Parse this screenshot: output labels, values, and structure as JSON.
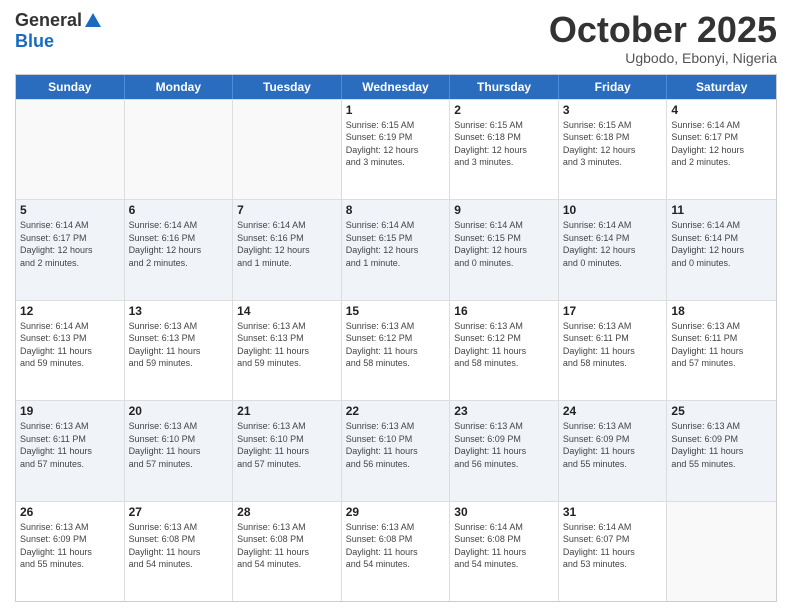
{
  "logo": {
    "general": "General",
    "blue": "Blue"
  },
  "header": {
    "month": "October 2025",
    "location": "Ugbodo, Ebonyi, Nigeria"
  },
  "dayHeaders": [
    "Sunday",
    "Monday",
    "Tuesday",
    "Wednesday",
    "Thursday",
    "Friday",
    "Saturday"
  ],
  "weeks": [
    [
      {
        "day": "",
        "info": ""
      },
      {
        "day": "",
        "info": ""
      },
      {
        "day": "",
        "info": ""
      },
      {
        "day": "1",
        "info": "Sunrise: 6:15 AM\nSunset: 6:19 PM\nDaylight: 12 hours\nand 3 minutes."
      },
      {
        "day": "2",
        "info": "Sunrise: 6:15 AM\nSunset: 6:18 PM\nDaylight: 12 hours\nand 3 minutes."
      },
      {
        "day": "3",
        "info": "Sunrise: 6:15 AM\nSunset: 6:18 PM\nDaylight: 12 hours\nand 3 minutes."
      },
      {
        "day": "4",
        "info": "Sunrise: 6:14 AM\nSunset: 6:17 PM\nDaylight: 12 hours\nand 2 minutes."
      }
    ],
    [
      {
        "day": "5",
        "info": "Sunrise: 6:14 AM\nSunset: 6:17 PM\nDaylight: 12 hours\nand 2 minutes."
      },
      {
        "day": "6",
        "info": "Sunrise: 6:14 AM\nSunset: 6:16 PM\nDaylight: 12 hours\nand 2 minutes."
      },
      {
        "day": "7",
        "info": "Sunrise: 6:14 AM\nSunset: 6:16 PM\nDaylight: 12 hours\nand 1 minute."
      },
      {
        "day": "8",
        "info": "Sunrise: 6:14 AM\nSunset: 6:15 PM\nDaylight: 12 hours\nand 1 minute."
      },
      {
        "day": "9",
        "info": "Sunrise: 6:14 AM\nSunset: 6:15 PM\nDaylight: 12 hours\nand 0 minutes."
      },
      {
        "day": "10",
        "info": "Sunrise: 6:14 AM\nSunset: 6:14 PM\nDaylight: 12 hours\nand 0 minutes."
      },
      {
        "day": "11",
        "info": "Sunrise: 6:14 AM\nSunset: 6:14 PM\nDaylight: 12 hours\nand 0 minutes."
      }
    ],
    [
      {
        "day": "12",
        "info": "Sunrise: 6:14 AM\nSunset: 6:13 PM\nDaylight: 11 hours\nand 59 minutes."
      },
      {
        "day": "13",
        "info": "Sunrise: 6:13 AM\nSunset: 6:13 PM\nDaylight: 11 hours\nand 59 minutes."
      },
      {
        "day": "14",
        "info": "Sunrise: 6:13 AM\nSunset: 6:13 PM\nDaylight: 11 hours\nand 59 minutes."
      },
      {
        "day": "15",
        "info": "Sunrise: 6:13 AM\nSunset: 6:12 PM\nDaylight: 11 hours\nand 58 minutes."
      },
      {
        "day": "16",
        "info": "Sunrise: 6:13 AM\nSunset: 6:12 PM\nDaylight: 11 hours\nand 58 minutes."
      },
      {
        "day": "17",
        "info": "Sunrise: 6:13 AM\nSunset: 6:11 PM\nDaylight: 11 hours\nand 58 minutes."
      },
      {
        "day": "18",
        "info": "Sunrise: 6:13 AM\nSunset: 6:11 PM\nDaylight: 11 hours\nand 57 minutes."
      }
    ],
    [
      {
        "day": "19",
        "info": "Sunrise: 6:13 AM\nSunset: 6:11 PM\nDaylight: 11 hours\nand 57 minutes."
      },
      {
        "day": "20",
        "info": "Sunrise: 6:13 AM\nSunset: 6:10 PM\nDaylight: 11 hours\nand 57 minutes."
      },
      {
        "day": "21",
        "info": "Sunrise: 6:13 AM\nSunset: 6:10 PM\nDaylight: 11 hours\nand 57 minutes."
      },
      {
        "day": "22",
        "info": "Sunrise: 6:13 AM\nSunset: 6:10 PM\nDaylight: 11 hours\nand 56 minutes."
      },
      {
        "day": "23",
        "info": "Sunrise: 6:13 AM\nSunset: 6:09 PM\nDaylight: 11 hours\nand 56 minutes."
      },
      {
        "day": "24",
        "info": "Sunrise: 6:13 AM\nSunset: 6:09 PM\nDaylight: 11 hours\nand 55 minutes."
      },
      {
        "day": "25",
        "info": "Sunrise: 6:13 AM\nSunset: 6:09 PM\nDaylight: 11 hours\nand 55 minutes."
      }
    ],
    [
      {
        "day": "26",
        "info": "Sunrise: 6:13 AM\nSunset: 6:09 PM\nDaylight: 11 hours\nand 55 minutes."
      },
      {
        "day": "27",
        "info": "Sunrise: 6:13 AM\nSunset: 6:08 PM\nDaylight: 11 hours\nand 54 minutes."
      },
      {
        "day": "28",
        "info": "Sunrise: 6:13 AM\nSunset: 6:08 PM\nDaylight: 11 hours\nand 54 minutes."
      },
      {
        "day": "29",
        "info": "Sunrise: 6:13 AM\nSunset: 6:08 PM\nDaylight: 11 hours\nand 54 minutes."
      },
      {
        "day": "30",
        "info": "Sunrise: 6:14 AM\nSunset: 6:08 PM\nDaylight: 11 hours\nand 54 minutes."
      },
      {
        "day": "31",
        "info": "Sunrise: 6:14 AM\nSunset: 6:07 PM\nDaylight: 11 hours\nand 53 minutes."
      },
      {
        "day": "",
        "info": ""
      }
    ]
  ]
}
